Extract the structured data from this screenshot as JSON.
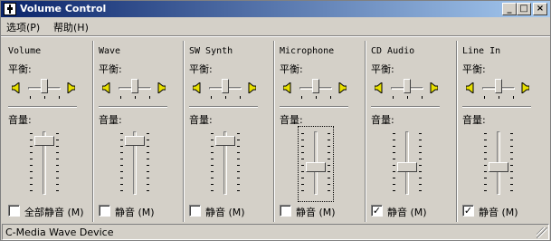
{
  "window": {
    "title": "Volume Control",
    "minimize_glyph": "_",
    "maximize_glyph": "□",
    "close_glyph": "×"
  },
  "menu": {
    "options": "选项(P)",
    "help": "帮助(H)"
  },
  "balance_label": "平衡:",
  "volume_label": "音量:",
  "channels": [
    {
      "name": "Volume",
      "mute_label": "全部静音 (M)",
      "muted": false,
      "volume": 0.92,
      "balance": 0.5
    },
    {
      "name": "Wave",
      "mute_label": "静音 (M)",
      "muted": false,
      "volume": 0.92,
      "balance": 0.5
    },
    {
      "name": "SW Synth",
      "mute_label": "静音 (M)",
      "muted": false,
      "volume": 0.92,
      "balance": 0.5
    },
    {
      "name": "Microphone",
      "mute_label": "静音 (M)",
      "muted": false,
      "volume": 0.45,
      "balance": 0.5
    },
    {
      "name": "CD Audio",
      "mute_label": "静音 (M)",
      "muted": true,
      "volume": 0.45,
      "balance": 0.5
    },
    {
      "name": "Line In",
      "mute_label": "静音 (M)",
      "muted": true,
      "volume": 0.45,
      "balance": 0.5
    }
  ],
  "status": "C-Media Wave Device",
  "colors": {
    "face": "#d4d0c8",
    "title_start": "#0a246a",
    "title_end": "#a6caf0",
    "speaker": "#e8e000"
  }
}
